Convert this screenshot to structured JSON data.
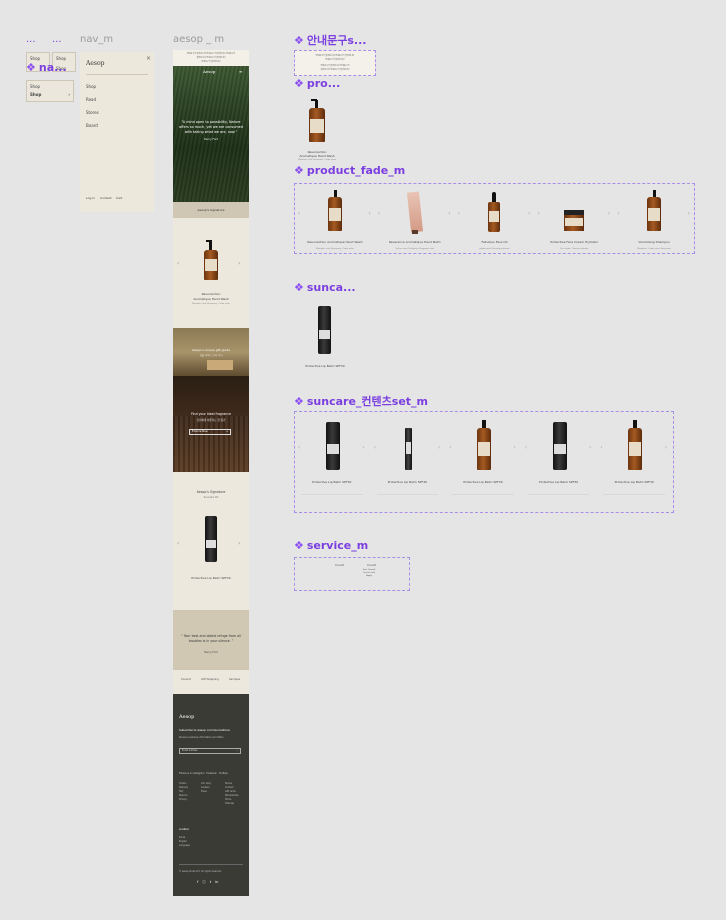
{
  "frames": {
    "dots1": "...",
    "dots2": "...",
    "nav_m": "nav_m",
    "aesop_m": "aesop _ m"
  },
  "components": {
    "nav_small": "na...",
    "notice": "안내문구s...",
    "pro": "pro...",
    "product_fade": "product_fade_m",
    "sunca": "sunca...",
    "suncare_set": "suncare_컨텐츠set_m",
    "service": "service_m"
  },
  "nav_small": {
    "shop1": "Shop",
    "shop2": "Shop",
    "shop3": "Shop",
    "shop_bold": "Shop",
    "chevron": "›"
  },
  "nav_m": {
    "logo": "Aesop",
    "close": "×",
    "items": [
      "Shop",
      "Read",
      "Stores",
      "Board"
    ],
    "footer": [
      "Log in",
      "Contact",
      "Cart"
    ]
  },
  "aesop_m": {
    "notice_lines": [
      "안내문구가 들어갑니다 안내문구가 들어갑니다 안내문구가",
      "들어갑니다 안내문구가 들어갑니다",
      "안내문구가 들어갑니다"
    ],
    "hero": {
      "logo": "Aesop",
      "quote": "“A mind open to possibility, Nature offers so much, yet we are consumed with taking what we are, now.”",
      "author": "Henry Ford"
    },
    "signature_title": "Aesop's Signature",
    "product1": {
      "name1": "Resurrection",
      "name2": "Aromatique Hand Wash",
      "sub": "Mandarin rind, Rosemary, Cedar atlas"
    },
    "gift": {
      "line1": "Aesop's unique gift guide",
      "line2": "선물 가이드 보러 가기"
    },
    "fragrance": {
      "line1": "Find your ideal fragrance",
      "line2": "당신에게 어울리는 향 찾기",
      "btn": "Explore Now"
    },
    "signature2": {
      "line1": "Aesop's Signature",
      "line2": "Suncare Kit",
      "product": "Protective Lip Balm SPF30"
    },
    "quote": {
      "text": "“ Your best and oldest refuge from all troubles is in your silence. ”",
      "author": "Henry Ford"
    },
    "service_links": [
      "Consult",
      "Gift Wrapping",
      "Samples"
    ],
    "footer": {
      "logo": "Aesop",
      "subscribe_title": "Subscribe to Aesop communications",
      "subscribe_text": "Receive exclusive information and offers",
      "email_placeholder": "Email address",
      "follow": "Follow us on Instagram · Facebook · YouTube",
      "col1": [
        "Orders",
        "Delivery",
        "FAQ",
        "Returns",
        "Privacy"
      ],
      "col2": [
        "Our story",
        "Careers",
        "Press"
      ],
      "col3": [
        "Stores",
        "Contact",
        "Gift cards",
        "Membership",
        "Terms",
        "Sitemap"
      ],
      "bottom_title": "Location",
      "bottom_lines": [
        "Korea",
        "English",
        "Language"
      ],
      "copyright": "© Aesop Korea Ltd. All rights reserved.",
      "social": [
        "f",
        "ⓘ",
        "t",
        "in"
      ]
    }
  },
  "notice_box": {
    "line1": "안내문구가 들어갑니다 안내문구가 들어갑니다",
    "line2": "안내문구가 들어갑니다",
    "line3": "안내문구가 들어갑니다 안내문구가",
    "line4": "들어갑니다 안내문구가 들어갑니다"
  },
  "pro_card": {
    "name1": "Resurrection",
    "name2": "Aromatique Hand Wash",
    "sub": "Mandarin rind, Rosemary, Cedar atlas"
  },
  "fade_products": [
    {
      "name": "Resurrection Aromatique Hand Wash",
      "sub": "Mandarin rind, Rosemary, Cedar atlas",
      "type": "pump"
    },
    {
      "name": "Reverence Aromatique Hand Balm",
      "sub": "Vetiver root, Petitgrain, Bergamot rind",
      "type": "tube"
    },
    {
      "name": "Fabulous Face Oil",
      "sub": "Jojoba seed, Evening primrose",
      "type": "dropper"
    },
    {
      "name": "Protective Face Cream Hydrator",
      "sub": "Zinc oxide, Titanium dioxide",
      "type": "jar"
    },
    {
      "name": "Volumising Shampoo",
      "sub": "Mandarin, Cedar atlas, Rosemary",
      "type": "pump"
    }
  ],
  "sunca_card": {
    "name": "Protective Lip Balm SPF30"
  },
  "suncare_products": [
    {
      "name": "Protective Lip Balm SPF30",
      "type": "black"
    },
    {
      "name": "Protective Lip Balm SPF30",
      "type": "stick"
    },
    {
      "name": "Protective Lip Balm SPF30",
      "type": "amber"
    },
    {
      "name": "Protective Lip Balm SPF30",
      "type": "black"
    },
    {
      "name": "Protective Lip Balm SPF30",
      "type": "amber"
    }
  ],
  "service_card": {
    "col1": "Consult",
    "col2_title": "Consult",
    "col2_lines": [
      "Free Consult",
      "Service Info",
      "Apply"
    ]
  },
  "colors": {
    "label_purple": "#7b3fe0",
    "beige": "#ece8db",
    "forest": "#2f4a26",
    "footer_dark": "#3a3b35"
  }
}
